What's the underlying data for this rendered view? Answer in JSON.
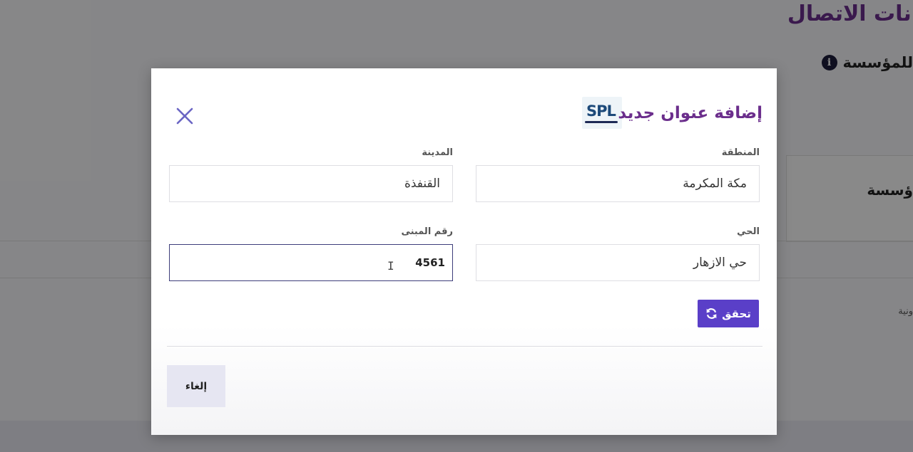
{
  "background": {
    "page_title": "انات الاتصال",
    "section_label": "للمؤسسة",
    "info_icon": "info-icon",
    "box_label": "ؤسسة",
    "small_text": "ونية"
  },
  "modal": {
    "title": "إضافة عنوان جديد",
    "logo_text": "SPL",
    "close_icon": "close-icon",
    "fields": {
      "region": {
        "label": "المنطقة",
        "value": "مكة المكرمة"
      },
      "city": {
        "label": "المدينة",
        "value": "القنفذة"
      },
      "district": {
        "label": "الحي",
        "value": "حي الازهار"
      },
      "building_number": {
        "label": "رقم المبنى",
        "value": "4561"
      }
    },
    "verify_button": {
      "label": "تحقق",
      "icon": "refresh-icon"
    },
    "cancel_button": {
      "label": "إلغاء"
    }
  },
  "colors": {
    "title": "#6b2e8c",
    "primary_button": "#5a3fc8",
    "close_icon": "#6b66c4",
    "cancel_button_bg": "#e6e6f2"
  }
}
